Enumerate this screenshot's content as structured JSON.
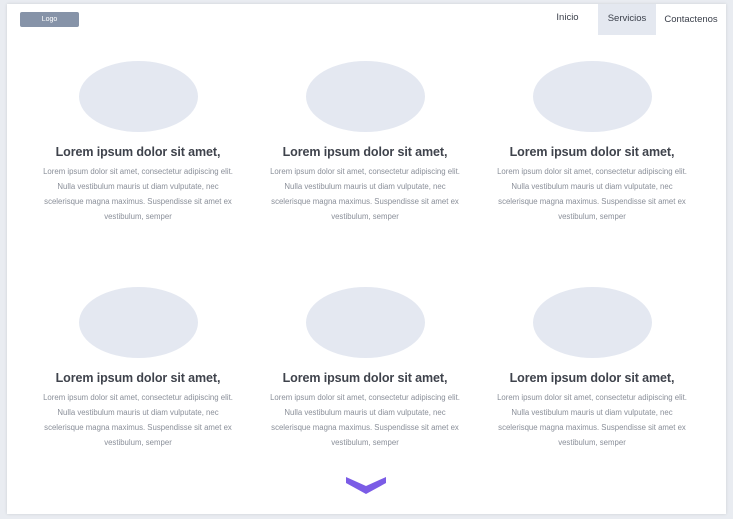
{
  "header": {
    "logo_label": "Logo",
    "nav": {
      "inicio": "Inicio",
      "servicios": "Servicios",
      "contactenos": "Contactenos"
    }
  },
  "cards": [
    {
      "title": "Lorem ipsum dolor sit amet,",
      "desc": "Lorem ipsum dolor sit amet, consectetur adipiscing elit. Nulla vestibulum mauris ut diam vulputate, nec scelerisque magna maximus. Suspendisse sit amet ex vestibulum, semper"
    },
    {
      "title": "Lorem ipsum dolor sit amet,",
      "desc": "Lorem ipsum dolor sit amet, consectetur adipiscing elit. Nulla vestibulum mauris ut diam vulputate, nec scelerisque magna maximus. Suspendisse sit amet ex vestibulum, semper"
    },
    {
      "title": "Lorem ipsum dolor sit amet,",
      "desc": "Lorem ipsum dolor sit amet, consectetur adipiscing elit. Nulla vestibulum mauris ut diam vulputate, nec scelerisque magna maximus. Suspendisse sit amet ex vestibulum, semper"
    },
    {
      "title": "Lorem ipsum dolor sit amet,",
      "desc": "Lorem ipsum dolor sit amet, consectetur adipiscing elit. Nulla vestibulum mauris ut diam vulputate, nec scelerisque magna maximus. Suspendisse sit amet ex vestibulum, semper"
    },
    {
      "title": "Lorem ipsum dolor sit amet,",
      "desc": "Lorem ipsum dolor sit amet, consectetur adipiscing elit. Nulla vestibulum mauris ut diam vulputate, nec scelerisque magna maximus. Suspendisse sit amet ex vestibulum, semper"
    },
    {
      "title": "Lorem ipsum dolor sit amet,",
      "desc": "Lorem ipsum dolor sit amet, consectetur adipiscing elit. Nulla vestibulum mauris ut diam vulputate, nec scelerisque magna maximus. Suspendisse sit amet ex vestibulum, semper"
    }
  ],
  "icons": {
    "scroll_down": "chevron-down-icon"
  },
  "colors": {
    "logo_bg": "#8693a8",
    "nav_active_bg": "#e4e8f0",
    "placeholder": "#e4e8f1",
    "accent": "#7b5ce6"
  }
}
